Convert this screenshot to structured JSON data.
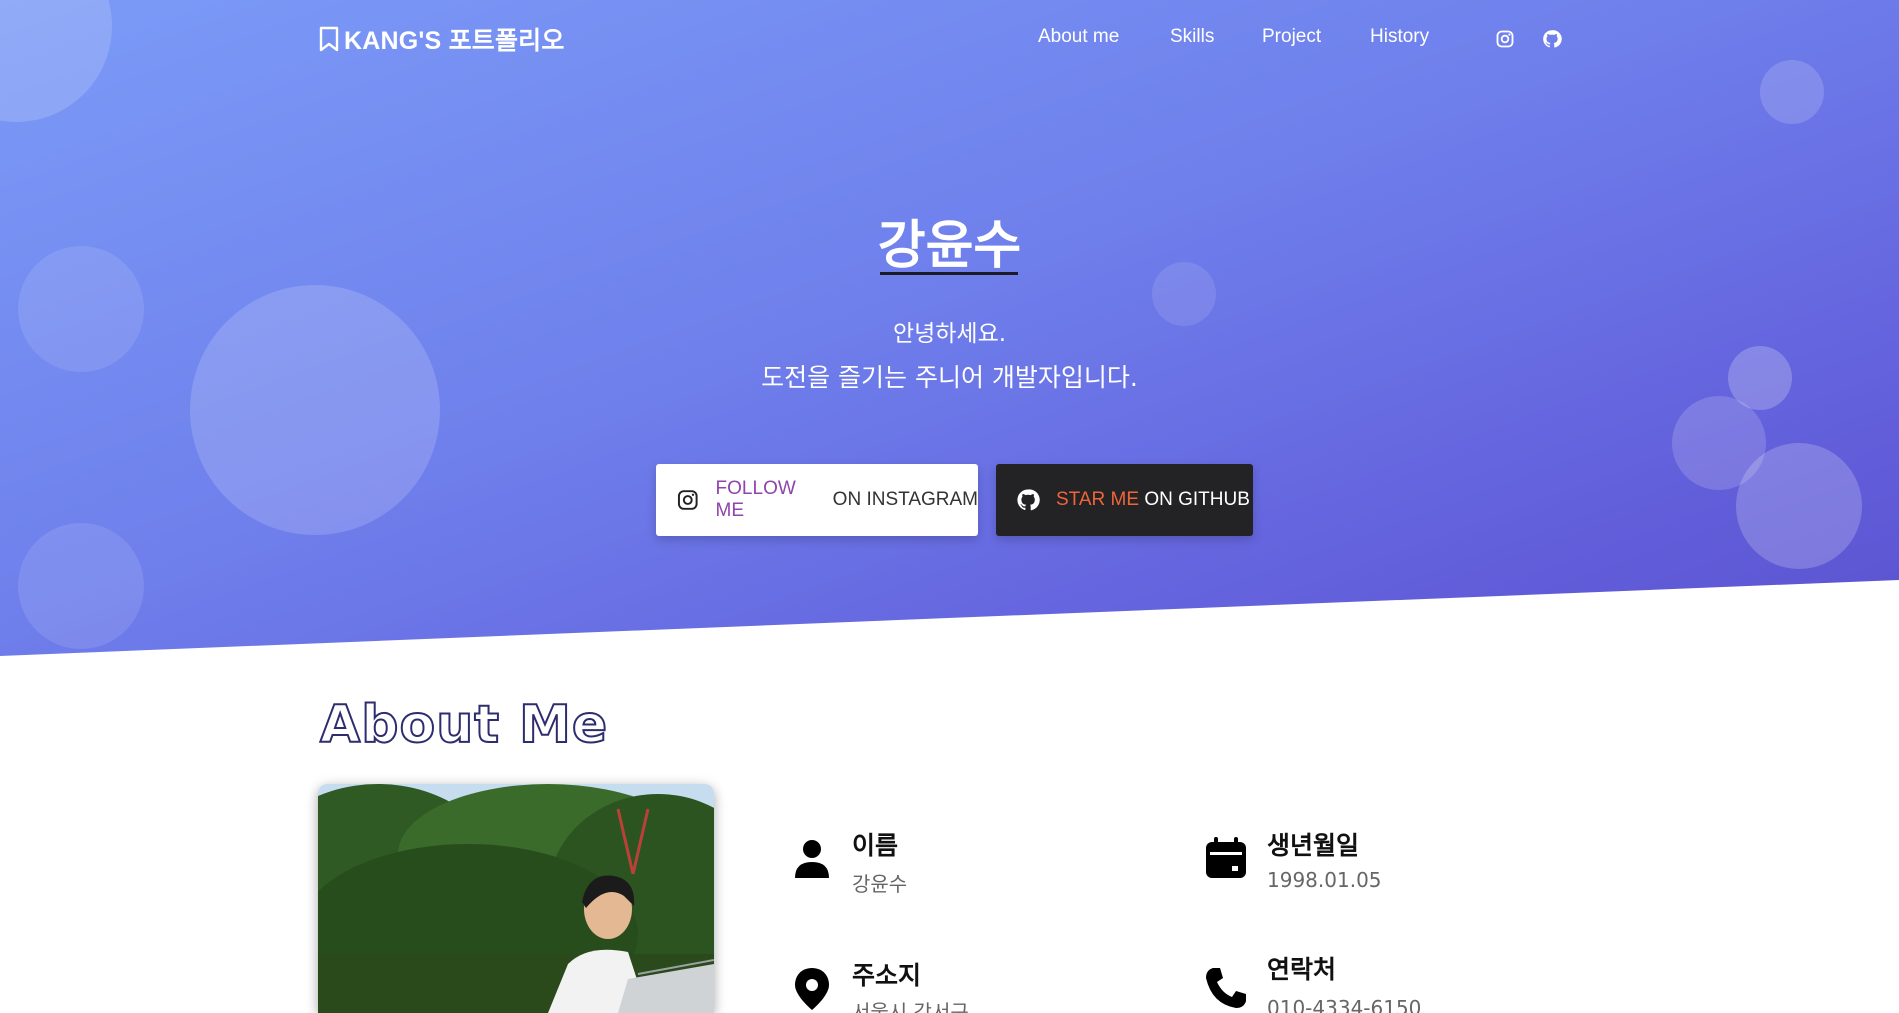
{
  "brand": {
    "title": "KANG'S 포트폴리오"
  },
  "nav": {
    "links": [
      "About me",
      "Skills",
      "Project",
      "History"
    ],
    "icons": [
      "instagram-icon",
      "github-icon"
    ]
  },
  "hero": {
    "name": "강윤수",
    "greeting": "안녕하세요.",
    "tagline": "도전을 즐기는 주니어 개발자입니다.",
    "instagram_button": {
      "accent": "FOLLOW ME",
      "rest": " ON INSTAGRAM"
    },
    "github_button": {
      "accent": "STAR ME",
      "rest": " ON GITHUB"
    }
  },
  "about": {
    "title": "About Me",
    "items": [
      {
        "label": "이름",
        "value": "강윤수",
        "icon": "person-icon"
      },
      {
        "label": "생년월일",
        "value": "1998.01.05",
        "icon": "calendar-icon"
      },
      {
        "label": "주소지",
        "value": "서울시 강서구",
        "icon": "location-icon"
      },
      {
        "label": "연락처",
        "value": "010-4334-6150",
        "icon": "phone-icon"
      }
    ]
  },
  "colors": {
    "hero_start": "#7b9bf7",
    "hero_end": "#5a52cf",
    "instagram_accent": "#8e44ad",
    "github_accent": "#f0643a",
    "github_button_bg": "#232326"
  }
}
